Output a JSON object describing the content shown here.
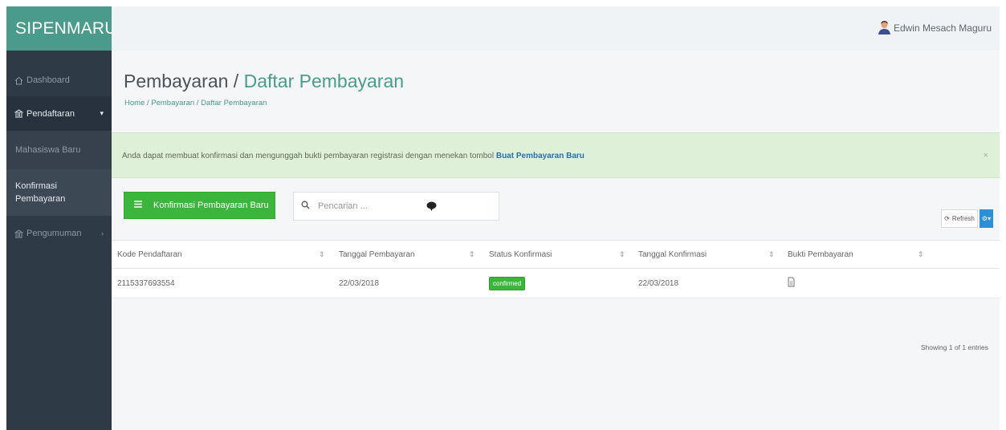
{
  "brand": "SIPENMARU",
  "user": {
    "name": "Edwin Mesach Maguru"
  },
  "sidebar": {
    "items": [
      {
        "label": "Dashboard",
        "icon": "home-icon"
      },
      {
        "label": "Pendaftaran",
        "icon": "bank-icon"
      },
      {
        "label": "Mahasiswa Baru",
        "icon": ""
      },
      {
        "label": "Konfirmasi Pembayaran",
        "icon": ""
      },
      {
        "label": "Pengumuman",
        "icon": "bank-icon"
      }
    ]
  },
  "page": {
    "title": "Pembayaran",
    "title_sep": " / ",
    "title_accent": "Daftar Pembayaran",
    "breadcrumb": [
      "Home",
      "Pembayaran",
      "Daftar Pembayaran"
    ]
  },
  "alert": {
    "text": "Anda dapat membuat konfirmasi dan mengunggah bukti pembayaran registrasi dengan menekan tombol",
    "highlight": "Buat Pembayaran Baru",
    "close": "×"
  },
  "toolbar": {
    "new_button": "Konfirmasi Pembayaran Baru",
    "search_placeholder": "Pencarian ...",
    "refresh": "Refresh"
  },
  "table": {
    "columns": [
      "Kode Pendaftaran",
      "Tanggal Pembayaran",
      "Status Konfirmasi",
      "Tanggal Konfirmasi",
      "Bukti Pembayaran"
    ],
    "rows": [
      {
        "kode": "2115337693554",
        "tanggal_pembayaran": "22/03/2018",
        "status": "confirmed",
        "tanggal_konfirmasi": "22/03/2018",
        "bukti_icon": "file-icon"
      }
    ]
  },
  "footer": {
    "showing": "Showing 1 of 1 entries"
  },
  "colors": {
    "sidebar": "#2f3a47",
    "brand": "#4a9b8c",
    "accent": "#4a9b8c",
    "success": "#3bb53b",
    "alert_bg": "#dff0d8",
    "link": "#2c6eab"
  }
}
